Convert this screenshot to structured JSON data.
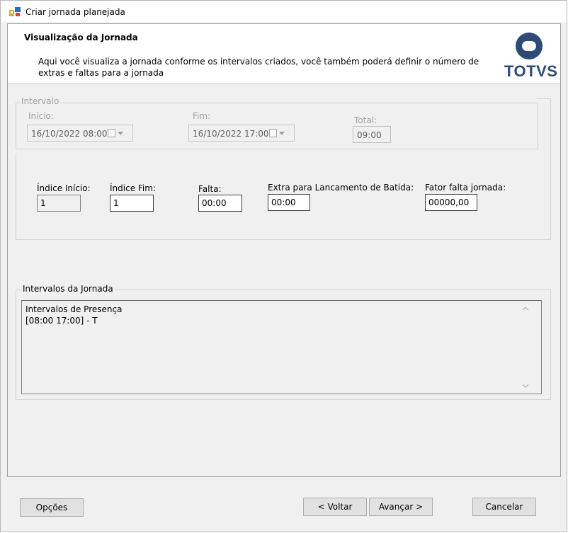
{
  "window": {
    "title": "Criar jornada planejada"
  },
  "header": {
    "title": "Visualização da Jornada",
    "description": "Aqui você visualiza a jornada conforme os intervalos criados, você também poderá definir o número de extras e faltas para a jornada",
    "logo_text": "TOTVS"
  },
  "interval": {
    "legend": "Intervalo",
    "start_label": "Início:",
    "start_value": "16/10/2022 08:00",
    "end_label": "Fim:",
    "end_value": "16/10/2022 17:00",
    "total_label": "Total:",
    "total_value": "09:00"
  },
  "fields": {
    "index_start_label": "Índice Início:",
    "index_start_value": "1",
    "index_end_label": "Índice Fim:",
    "index_end_value": "1",
    "absence_label": "Falta:",
    "absence_value": "00:00",
    "extra_label": "Extra para Lancamento de Batida:",
    "extra_value": "00:00",
    "factor_label": "Fator falta jornada:",
    "factor_value": "00000,00"
  },
  "intervals_group": {
    "legend": "Intervalos da Jornada",
    "lines": [
      "Intervalos de Presença",
      "[08:00 17:00] - T"
    ]
  },
  "footer": {
    "options": "Opções",
    "back": "< Voltar",
    "next": "Avançar >",
    "cancel": "Cancelar"
  },
  "colors": {
    "logo": "#2d4b75",
    "background": "#f0f0f0"
  }
}
